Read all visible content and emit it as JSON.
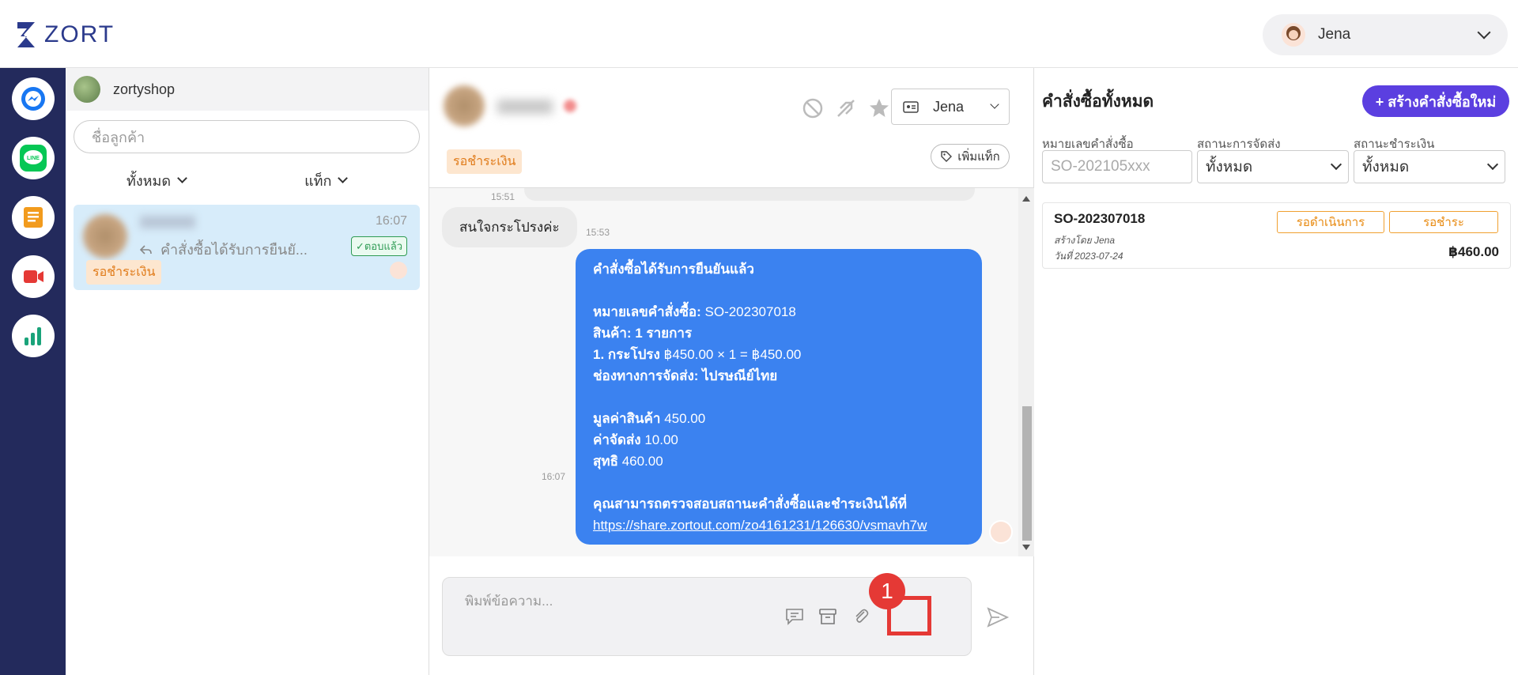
{
  "app": {
    "logo_text": "ZORT",
    "user_name": "Jena"
  },
  "sidebar": {
    "channels": [
      {
        "name": "messenger-icon",
        "color": "#1877f2"
      },
      {
        "name": "line-icon",
        "color": "#06c755"
      },
      {
        "name": "notes-icon",
        "color": "#f29b1d"
      },
      {
        "name": "video-icon",
        "color": "#e53935"
      },
      {
        "name": "stats-icon",
        "color": "#1aa37a"
      }
    ]
  },
  "conversation_list": {
    "shop_name": "zortyshop",
    "search_placeholder": "ชื่อลูกค้า",
    "filter_all": "ทั้งหมด",
    "filter_tag": "แท็ก",
    "items": [
      {
        "time": "16:07",
        "preview": "คำสั่งซื้อได้รับการยืนยั...",
        "replied_badge": "✓ตอบแล้ว",
        "tag": "รอชำระเงิน"
      }
    ]
  },
  "chat": {
    "assignee": "Jena",
    "tag": "รอชำระเงิน",
    "add_tag_label": "เพิ่มแท็ก",
    "time_top": "15:51",
    "incoming_message": "สนใจกระโปรงค่ะ",
    "incoming_time": "15:53",
    "outgoing_time": "16:07",
    "outgoing_lines": [
      {
        "text": "คำสั่งซื้อได้รับการยืนยันแล้ว",
        "bold": true
      },
      {
        "text": "",
        "bold": false
      },
      {
        "bold_part": "หมายเลขคำสั่งซื้อ:",
        "rest": " SO-202307018"
      },
      {
        "bold_part": "สินค้า: 1 รายการ",
        "rest": ""
      },
      {
        "bold_part": "1. กระโปรง",
        "rest": " ฿450.00 × 1 = ฿450.00"
      },
      {
        "bold_part": "ช่องทางการจัดส่ง: ไปรษณีย์ไทย",
        "rest": ""
      },
      {
        "text": "",
        "bold": false
      },
      {
        "bold_part": "มูลค่าสินค้า",
        "rest": " 450.00"
      },
      {
        "bold_part": "ค่าจัดส่ง",
        "rest": " 10.00"
      },
      {
        "bold_part": "สุทธิ",
        "rest": " 460.00"
      },
      {
        "text": "",
        "bold": false
      },
      {
        "bold_part": "คุณสามารถตรวจสอบสถานะคำสั่งซื้อและชำระเงินได้ที่",
        "rest": ""
      }
    ],
    "link": "https://share.zortout.com/zo4161231/126630/vsmavh7w",
    "composer_placeholder": "พิมพ์ข้อความ...",
    "step_badge": "1"
  },
  "orders": {
    "title": "คำสั่งซื้อทั้งหมด",
    "create_button": "+ สร้างคำสั่งซื้อใหม่",
    "filter_labels": [
      "หมายเลขคำสั่งซื้อ",
      "สถานะการจัดส่ง",
      "สถานะชำระเงิน"
    ],
    "order_no_placeholder": "SO-202105xxx",
    "shipping_status": "ทั้งหมด",
    "payment_status": "ทั้งหมด",
    "cards": [
      {
        "order_no": "SO-202307018",
        "created_by": "สร้างโดย Jena",
        "date": "วันที่ 2023-07-24",
        "status_1": "รอดำเนินการ",
        "status_2": "รอชำระ",
        "amount": "฿460.00"
      }
    ]
  },
  "colors": {
    "rail": "#232a5c",
    "accent": "#5b3fe0",
    "bubble_out": "#3b82f0",
    "highlight": "#e53935"
  }
}
